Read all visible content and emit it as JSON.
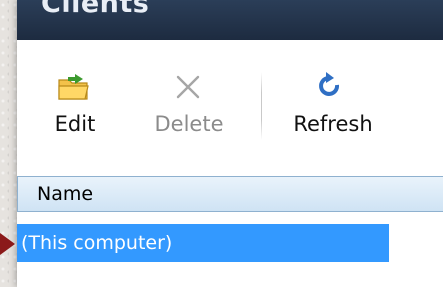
{
  "window": {
    "title": "Clients"
  },
  "toolbar": {
    "edit_label": "Edit",
    "delete_label": "Delete",
    "refresh_label": "Refresh",
    "icons": {
      "edit": "folder-edit-icon",
      "delete": "close-icon",
      "refresh": "refresh-icon"
    },
    "delete_enabled": false
  },
  "grid": {
    "columns": [
      "Name"
    ],
    "rows": [
      {
        "name": "(This computer)",
        "selected": true
      }
    ]
  },
  "colors": {
    "titlebar": "#1d2b40",
    "selection": "#3399ff",
    "header": "#cfe3f4",
    "pointer": "#8b1a1a"
  }
}
